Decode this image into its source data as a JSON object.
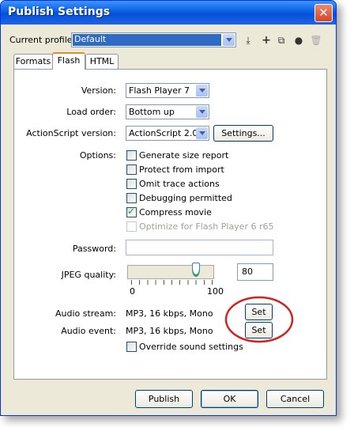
{
  "window": {
    "title": "Publish Settings",
    "close_glyph": "✕"
  },
  "profile": {
    "label": "Current profile:",
    "value": "Default"
  },
  "tabs": [
    {
      "label": "Formats"
    },
    {
      "label": "Flash"
    },
    {
      "label": "HTML"
    }
  ],
  "flash": {
    "version_label": "Version:",
    "version_value": "Flash Player 7",
    "load_order_label": "Load order:",
    "load_order_value": "Bottom up",
    "actionscript_label": "ActionScript version:",
    "actionscript_value": "ActionScript 2.0",
    "settings_button": "Settings...",
    "options_label": "Options:",
    "options": [
      {
        "label": "Generate size report",
        "checked": false,
        "disabled": false
      },
      {
        "label": "Protect from import",
        "checked": false,
        "disabled": false
      },
      {
        "label": "Omit trace actions",
        "checked": false,
        "disabled": false
      },
      {
        "label": "Debugging permitted",
        "checked": false,
        "disabled": false
      },
      {
        "label": "Compress movie",
        "checked": true,
        "disabled": false
      },
      {
        "label": "Optimize for Flash Player 6 r65",
        "checked": false,
        "disabled": true
      }
    ],
    "password_label": "Password:",
    "jpeg_label": "JPEG quality:",
    "jpeg_value": "80",
    "slider_min": "0",
    "slider_max": "100",
    "audio_stream_label": "Audio stream:",
    "audio_stream_value": "MP3, 16 kbps, Mono",
    "audio_event_label": "Audio event:",
    "audio_event_value": "MP3, 16 kbps, Mono",
    "set_label": "Set",
    "override_label": "Override sound settings"
  },
  "footer": {
    "publish": "Publish",
    "ok": "OK",
    "cancel": "Cancel"
  },
  "colors": {
    "title_bar": "#0a5fe0",
    "annotation_circle": "#d42020",
    "dialog_bg": "#ece9d8"
  }
}
